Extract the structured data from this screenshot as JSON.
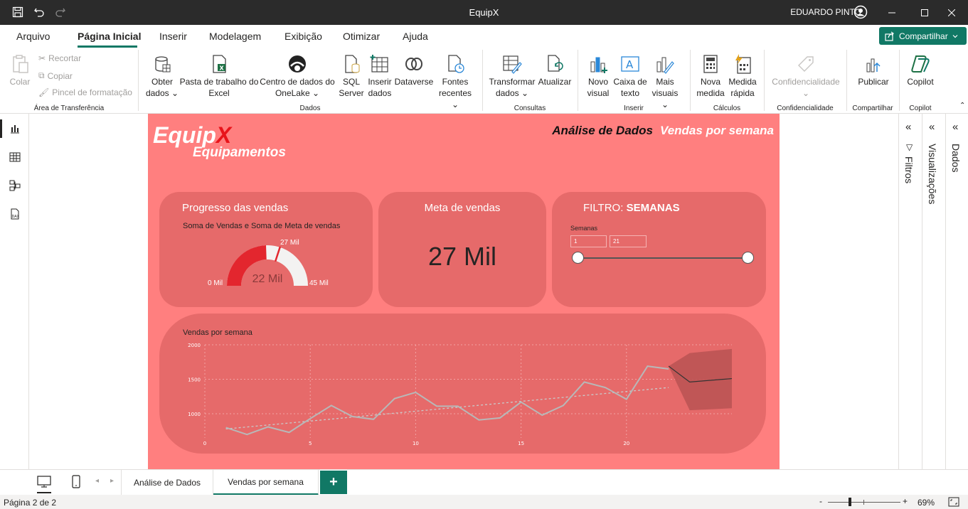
{
  "window": {
    "title": "EquipX",
    "user": "EDUARDO PINTO"
  },
  "menu": {
    "items": [
      "Arquivo",
      "Página Inicial",
      "Inserir",
      "Modelagem",
      "Exibição",
      "Otimizar",
      "Ajuda"
    ],
    "share": "Compartilhar"
  },
  "ribbon": {
    "clipboard": {
      "paste": "Colar",
      "cut": "Recortar",
      "copy": "Copiar",
      "format_painter": "Pincel de formatação",
      "group": "Área de Transferência"
    },
    "data": {
      "get_data_1": "Obter",
      "get_data_2": "dados",
      "excel_1": "Pasta de trabalho do",
      "excel_2": "Excel",
      "onelake_1": "Centro de dados do",
      "onelake_2": "OneLake",
      "sql_1": "SQL",
      "sql_2": "Server",
      "enter_1": "Inserir",
      "enter_2": "dados",
      "dataverse": "Dataverse",
      "recent_1": "Fontes",
      "recent_2": "recentes",
      "group": "Dados"
    },
    "queries": {
      "transform_1": "Transformar",
      "transform_2": "dados",
      "refresh": "Atualizar",
      "group": "Consultas"
    },
    "insert": {
      "visual_1": "Novo",
      "visual_2": "visual",
      "textbox_1": "Caixa de",
      "textbox_2": "texto",
      "more_1": "Mais",
      "more_2": "visuais",
      "group": "Inserir"
    },
    "calc": {
      "measure_1": "Nova",
      "measure_2": "medida",
      "quick_1": "Medida",
      "quick_2": "rápida",
      "group": "Cálculos"
    },
    "sensitivity": {
      "label": "Confidencialidade",
      "group": "Confidencialidade"
    },
    "share": {
      "publish": "Publicar",
      "group": "Compartilhar"
    },
    "copilot": {
      "label": "Copilot",
      "group": "Copilot"
    }
  },
  "report": {
    "logo_main": "Equip",
    "logo_accent": "X",
    "logo_sub": "Equipamentos",
    "header_title": "Análise de Dados",
    "header_subtitle": "Vendas por semana",
    "gauge_card": {
      "title": "Progresso das vendas",
      "subtitle": "Soma de Vendas e Soma de Meta de vendas",
      "value_label": "22 Mil",
      "min_label": "0 Mil",
      "max_label": "45 Mil",
      "target_label": "27 Mil",
      "value": 22,
      "min": 0,
      "max": 45,
      "target": 27
    },
    "kpi_card": {
      "title": "Meta de vendas",
      "value": "27 Mil"
    },
    "filter_card": {
      "title_prefix": "FILTRO: ",
      "title_bold": "SEMANAS",
      "label": "Semanas",
      "from": "1",
      "to": "21"
    }
  },
  "chart_data": {
    "type": "line",
    "title": "Vendas por semana",
    "xlabel": "",
    "ylabel": "",
    "x": [
      1,
      2,
      3,
      4,
      5,
      6,
      7,
      8,
      9,
      10,
      11,
      12,
      13,
      14,
      15,
      16,
      17,
      18,
      19,
      20,
      21,
      22
    ],
    "series": [
      {
        "values": [
          800,
          700,
          810,
          730,
          930,
          1120,
          960,
          920,
          1220,
          1310,
          1110,
          1110,
          910,
          940,
          1170,
          980,
          1120,
          1460,
          1380,
          1210,
          1690,
          1650
        ]
      }
    ],
    "trend_line": {
      "start": [
        1,
        780
      ],
      "end": [
        22,
        1380
      ]
    },
    "forecast": {
      "x": [
        22,
        23,
        25
      ],
      "values": [
        1690,
        1460,
        1510
      ],
      "upper": [
        1690,
        1880,
        1940
      ],
      "lower": [
        1690,
        1050,
        1080
      ]
    },
    "xticks": [
      "0",
      "5",
      "10",
      "15",
      "20"
    ],
    "yticks": [
      "1000",
      "1500",
      "2000"
    ],
    "xlim": [
      0,
      25
    ],
    "ylim": [
      650,
      2000
    ],
    "grid": true
  },
  "panes": {
    "filters": "Filtros",
    "visualizations": "Visualizações",
    "data": "Dados"
  },
  "tabs": {
    "tab1": "Análise de Dados",
    "tab2": "Vendas por semana",
    "add": "+"
  },
  "status": {
    "page": "Página 2 de 2",
    "zoom": "69%",
    "zoom_minus": "-",
    "zoom_plus": "+"
  }
}
